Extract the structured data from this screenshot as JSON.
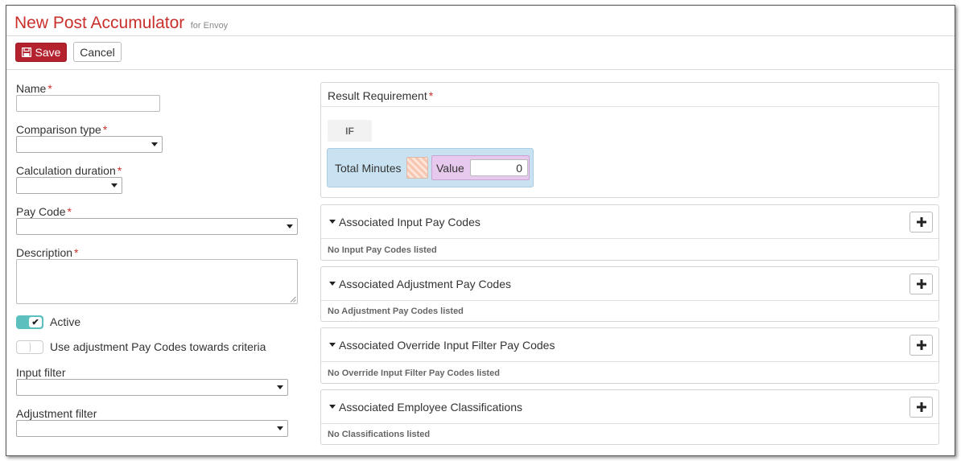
{
  "header": {
    "title": "New Post Accumulator",
    "subtitle": "for Envoy"
  },
  "toolbar": {
    "save_label": "Save",
    "cancel_label": "Cancel"
  },
  "form": {
    "name": {
      "label": "Name",
      "required_mark": "*",
      "value": ""
    },
    "comparison_type": {
      "label": "Comparison type",
      "required_mark": "*",
      "selected": ""
    },
    "calculation_duration": {
      "label": "Calculation duration",
      "required_mark": "*",
      "selected": ""
    },
    "pay_code": {
      "label": "Pay Code",
      "required_mark": "*",
      "selected": ""
    },
    "description": {
      "label": "Description",
      "required_mark": "*",
      "value": ""
    },
    "active": {
      "label": "Active",
      "checked": true,
      "check_glyph": "✔"
    },
    "use_adjustment": {
      "label": "Use adjustment Pay Codes towards criteria",
      "checked": false
    },
    "input_filter": {
      "label": "Input filter",
      "selected": ""
    },
    "adjustment_filter": {
      "label": "Adjustment filter",
      "selected": ""
    }
  },
  "result_requirement": {
    "title": "Result Requirement",
    "required_mark": "*",
    "if_label": "IF",
    "condition": {
      "field": "Total Minutes",
      "value_label": "Value",
      "value": "0"
    }
  },
  "panels": [
    {
      "title": "Associated Input Pay Codes",
      "empty_text": "No Input Pay Codes listed"
    },
    {
      "title": "Associated Adjustment Pay Codes",
      "empty_text": "No Adjustment Pay Codes listed"
    },
    {
      "title": "Associated Override Input Filter Pay Codes",
      "empty_text": "No Override Input Filter Pay Codes listed"
    },
    {
      "title": "Associated Employee Classifications",
      "empty_text": "No Classifications listed"
    }
  ],
  "colors": {
    "title_red": "#c9302c",
    "save_button": "#b5222f",
    "toggle_on": "#5bc0be",
    "condition_bg": "#c9e2f1",
    "value_bg": "#e7c9ee"
  },
  "icons": {
    "save": "floppy-disk-icon",
    "add": "plus-icon",
    "collapse": "caret-down-icon"
  }
}
